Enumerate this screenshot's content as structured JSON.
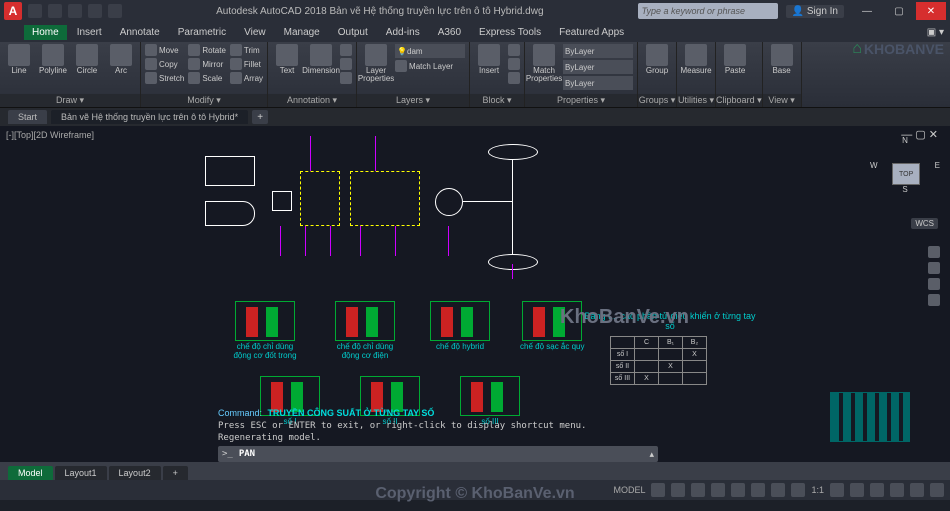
{
  "titlebar": {
    "app_title": "Autodesk AutoCAD 2018   Bản vẽ Hệ thống truyền lực trên ô tô Hybrid.dwg",
    "search_placeholder": "Type a keyword or phrase",
    "signin": "Sign In"
  },
  "menu": {
    "tabs": [
      "Home",
      "Insert",
      "Annotate",
      "Parametric",
      "View",
      "Manage",
      "Output",
      "Add-ins",
      "A360",
      "Express Tools",
      "Featured Apps"
    ],
    "active": 0
  },
  "ribbon": {
    "draw": {
      "label": "Draw ▾",
      "line": "Line",
      "polyline": "Polyline",
      "circle": "Circle",
      "arc": "Arc"
    },
    "modify": {
      "label": "Modify ▾",
      "move": "Move",
      "rotate": "Rotate",
      "trim": "Trim",
      "copy": "Copy",
      "mirror": "Mirror",
      "fillet": "Fillet",
      "stretch": "Stretch",
      "scale": "Scale",
      "array": "Array"
    },
    "annotation": {
      "label": "Annotation ▾",
      "text": "Text",
      "dimension": "Dimension"
    },
    "layers": {
      "label": "Layers ▾",
      "layerprops": "Layer\nProperties",
      "dam": "dam",
      "matchlayer": "Match Layer"
    },
    "block": {
      "label": "Block ▾",
      "insert": "Insert"
    },
    "properties": {
      "label": "Properties ▾",
      "match": "Match\nProperties",
      "bylayer": "ByLayer"
    },
    "groups": {
      "label": "Groups ▾",
      "group": "Group"
    },
    "utilities": {
      "label": "Utilities ▾",
      "measure": "Measure"
    },
    "clipboard": {
      "label": "Clipboard ▾",
      "paste": "Paste"
    },
    "view": {
      "label": "View ▾",
      "base": "Base"
    }
  },
  "file_tabs": {
    "start": "Start",
    "active": "Bản vẽ Hệ thống truyền lực trên ô tô Hybrid*"
  },
  "viewport": {
    "label": "[-][Top][2D Wireframe]",
    "compass": {
      "n": "N",
      "s": "S",
      "e": "E",
      "w": "W",
      "top": "TOP"
    },
    "wcs": "WCS",
    "nav_dash": "— ▢ ✕"
  },
  "drawing": {
    "modes": [
      {
        "label": "chế độ chỉ dùng\nđộng cơ đốt trong"
      },
      {
        "label": "chế độ chỉ dùng\nđộng cơ điện"
      },
      {
        "label": "chế độ hybrid"
      },
      {
        "label": "chế độ sạc\nắc quy"
      }
    ],
    "gears": [
      "số I",
      "số II",
      "số III"
    ],
    "table_title": "Bảng t...\ncác phần tử điều khiển ở từng tay số",
    "table": {
      "headers": [
        "",
        "C",
        "B₁",
        "B₂"
      ],
      "rows": [
        [
          "số I",
          "",
          "",
          "X"
        ],
        [
          "số II",
          "",
          "X",
          ""
        ],
        [
          "số III",
          "X",
          "",
          ""
        ]
      ]
    }
  },
  "command": {
    "kw": "Command:",
    "title": "TRUYỀN CÔNG SUẤT Ở TỪNG TAY SỐ",
    "hint": "Press ESC or ENTER to exit, or right-click to display shortcut menu.",
    "regen": "Regenerating model.",
    "prompt": ">_",
    "active": "PAN"
  },
  "layout_tabs": [
    "Model",
    "Layout1",
    "Layout2",
    "+"
  ],
  "statusbar": {
    "model": "MODEL",
    "scale": "1:1"
  },
  "watermarks": {
    "brand": "KhoBanVe.vn",
    "copyright": "Copyright © KhoBanVe.vn",
    "logo": "KHOBANVE"
  }
}
